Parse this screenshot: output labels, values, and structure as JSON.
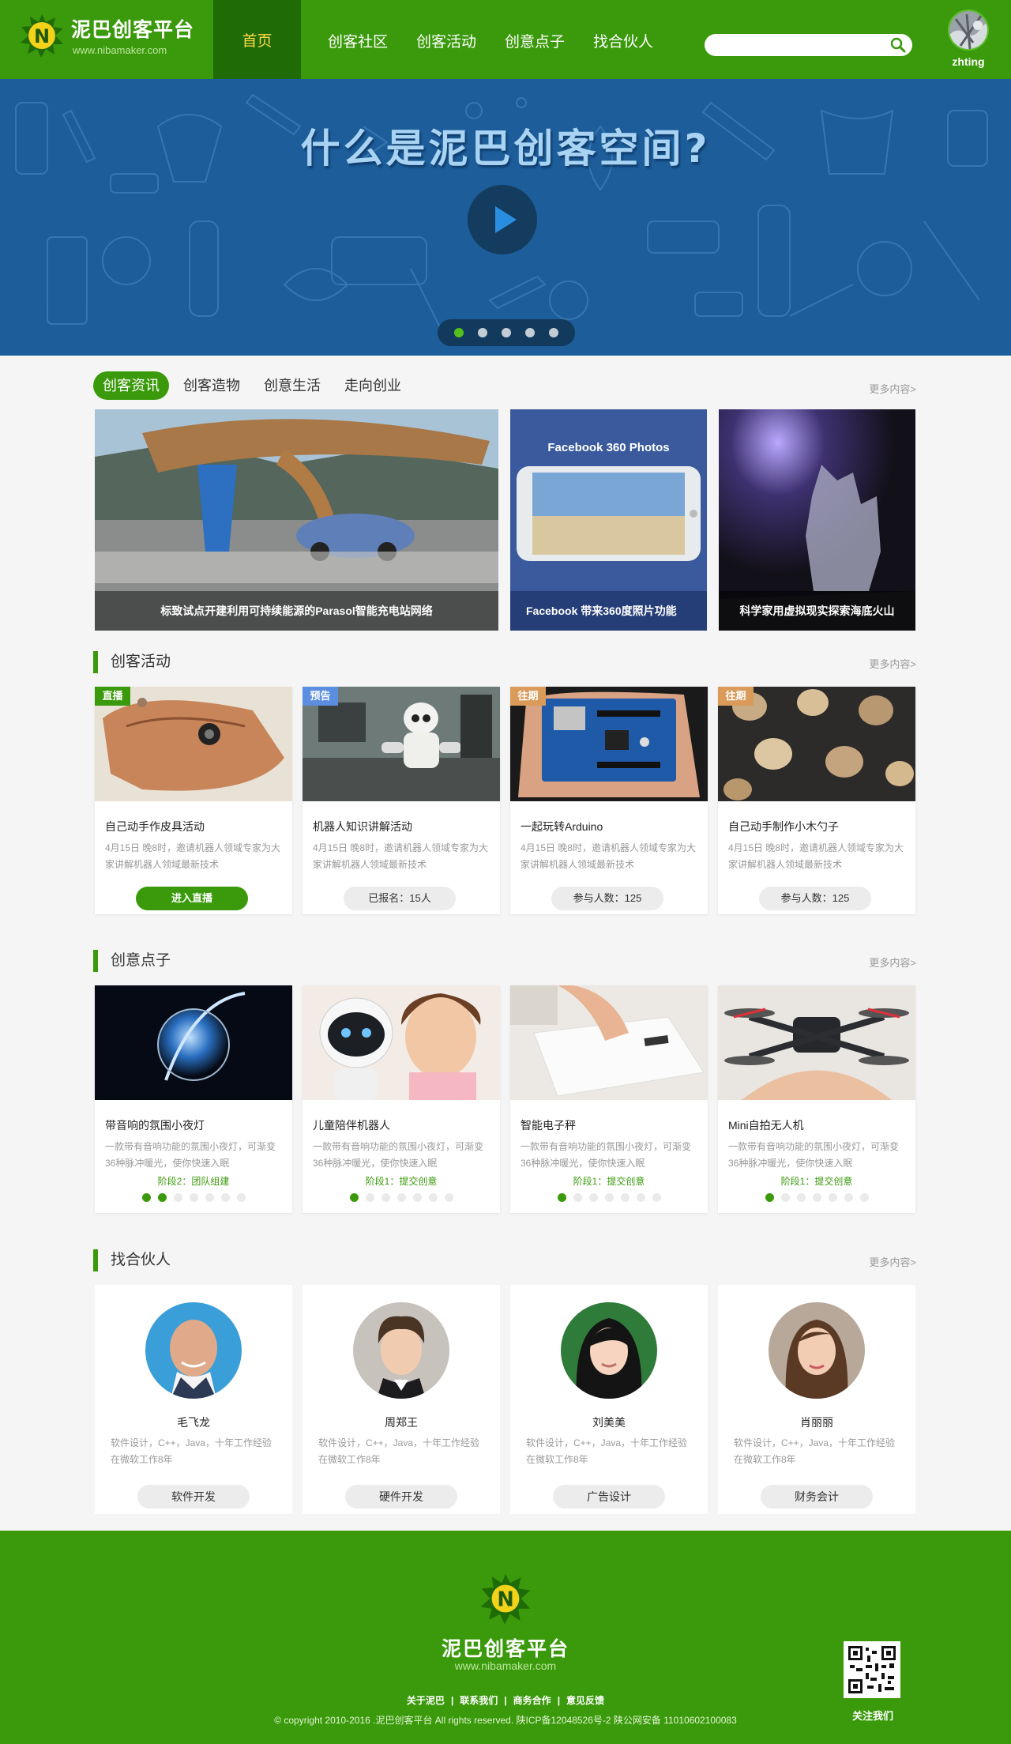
{
  "header": {
    "logo_title": "泥巴创客平台",
    "logo_url": "www.nibamaker.com",
    "nav": [
      "首页",
      "创客社区",
      "创客活动",
      "创意点子",
      "找合伙人"
    ],
    "search_placeholder": "",
    "user_name": "zhting"
  },
  "banner": {
    "title": "什么是泥巴创客空间?",
    "slides": 5,
    "active_slide": 1
  },
  "news": {
    "tabs": [
      "创客资讯",
      "创客造物",
      "创意生活",
      "走向创业"
    ],
    "more": "更多内容>",
    "items": [
      {
        "caption": "标致试点开建利用可持续能源的Parasol智能充电站网络"
      },
      {
        "caption": "Facebook 带来360度照片功能",
        "overlay": "Facebook 360 Photos"
      },
      {
        "caption": "科学家用虚拟现实探索海底火山"
      }
    ]
  },
  "activities": {
    "title": "创客活动",
    "more": "更多内容>",
    "items": [
      {
        "badge": "直播",
        "badge_color": "#3a9a0b",
        "title": "自己动手作皮具活动",
        "desc": "4月15日 晚8时，邀请机器人领域专家为大家讲解机器人领域最新技术",
        "button": "进入直播",
        "primary": true
      },
      {
        "badge": "预告",
        "badge_color": "#5b8de0",
        "title": "机器人知识讲解活动",
        "desc": "4月15日 晚8时，邀请机器人领域专家为大家讲解机器人领域最新技术",
        "button": "已报名：15人",
        "primary": false
      },
      {
        "badge": "往期",
        "badge_color": "#d99a5a",
        "title": "一起玩转Arduino",
        "desc": "4月15日 晚8时，邀请机器人领域专家为大家讲解机器人领域最新技术",
        "button": "参与人数：125",
        "primary": false
      },
      {
        "badge": "往期",
        "badge_color": "#d99a5a",
        "title": "自己动手制作小木勺子",
        "desc": "4月15日 晚8时，邀请机器人领域专家为大家讲解机器人领域最新技术",
        "button": "参与人数：125",
        "primary": false
      }
    ]
  },
  "ideas": {
    "title": "创意点子",
    "more": "更多内容>",
    "items": [
      {
        "title": "带音响的氛围小夜灯",
        "desc": "一款带有音响功能的氛围小夜灯，可渐变36种脉冲暖光，使你快速入眠",
        "stage": "阶段2：团队组建",
        "progress": 2,
        "steps": 7
      },
      {
        "title": "儿童陪伴机器人",
        "desc": "一款带有音响功能的氛围小夜灯，可渐变36种脉冲暖光，使你快速入眠",
        "stage": "阶段1：提交创意",
        "progress": 1,
        "steps": 7
      },
      {
        "title": "智能电子秤",
        "desc": "一款带有音响功能的氛围小夜灯，可渐变36种脉冲暖光，使你快速入眠",
        "stage": "阶段1：提交创意",
        "progress": 1,
        "steps": 7
      },
      {
        "title": "Mini自拍无人机",
        "desc": "一款带有音响功能的氛围小夜灯，可渐变36种脉冲暖光，使你快速入眠",
        "stage": "阶段1：提交创意",
        "progress": 1,
        "steps": 7
      }
    ]
  },
  "partners": {
    "title": "找合伙人",
    "more": "更多内容>",
    "items": [
      {
        "name": "毛飞龙",
        "desc": "软件设计，C++，Java，十年工作经验在微软工作8年",
        "tag": "软件开发"
      },
      {
        "name": "周郑王",
        "desc": "软件设计，C++，Java，十年工作经验在微软工作8年",
        "tag": "硬件开发"
      },
      {
        "name": "刘美美",
        "desc": "软件设计，C++，Java，十年工作经验在微软工作8年",
        "tag": "广告设计"
      },
      {
        "name": "肖丽丽",
        "desc": "软件设计，C++，Java，十年工作经验在微软工作8年",
        "tag": "财务会计"
      }
    ]
  },
  "footer": {
    "title": "泥巴创客平台",
    "url": "www.nibamaker.com",
    "links": [
      "关于泥巴",
      "联系我们",
      "商务合作",
      "意见反馈"
    ],
    "copyright": "© copyright 2010-2016 .泥巴创客平台 All rights reserved. 陕ICP备12048526号-2 陕公网安备 11010602100083",
    "qr_label": "关注我们"
  },
  "colors": {
    "brand": "#3a9a0b",
    "brand_dark": "#1f6b05",
    "banner": "#1c5d9a",
    "nav_active_text": "#ffd84a"
  }
}
